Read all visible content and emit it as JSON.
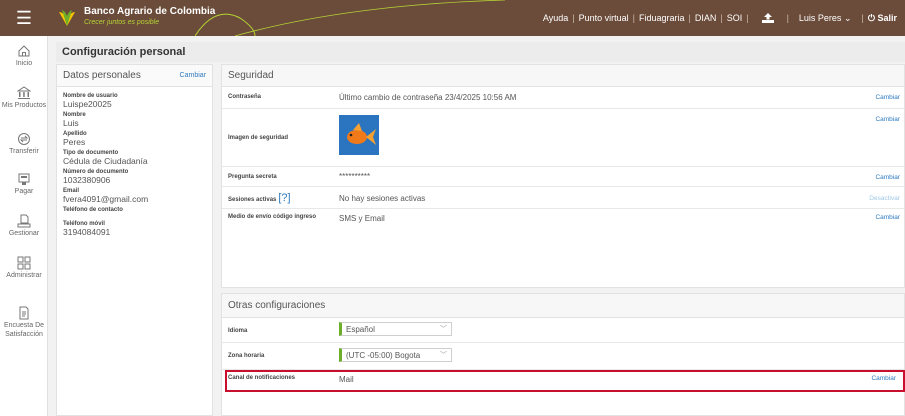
{
  "header": {
    "menu_icon": "hamburger-icon",
    "brand_name": "Banco Agrario de Colombia",
    "brand_slogan": "Crecer juntos es posible",
    "nav": [
      "Ayuda",
      "Punto virtual",
      "Fiduagraria",
      "DIAN",
      "SOI"
    ],
    "user_name": "Luis Peres",
    "logout_label": "Salir"
  },
  "sidebar": {
    "items": [
      {
        "label": "Inicio",
        "icon": "home-icon"
      },
      {
        "label": "Mis Productos",
        "icon": "bank-icon"
      },
      {
        "label": "Transferir",
        "icon": "transfer-icon"
      },
      {
        "label": "Pagar",
        "icon": "pay-icon"
      },
      {
        "label": "Gestionar",
        "icon": "manage-icon"
      },
      {
        "label": "Administrar",
        "icon": "grid-icon"
      },
      {
        "label": "Encuesta De Satisfacción",
        "icon": "survey-icon"
      }
    ]
  },
  "page": {
    "title": "Configuración personal"
  },
  "personal": {
    "title": "Datos personales",
    "action": "Cambiar",
    "fields": [
      {
        "label": "Nombre de usuario",
        "value": "Luispe20025"
      },
      {
        "label": "Nombre",
        "value": "Luis"
      },
      {
        "label": "Apellido",
        "value": "Peres"
      },
      {
        "label": "Tipo de documento",
        "value": "Cédula de Ciudadanía"
      },
      {
        "label": "Número de documento",
        "value": "1032380906"
      },
      {
        "label": "Email",
        "value": "fvera4091@gmail.com"
      },
      {
        "label": "Teléfono de contacto",
        "value": ""
      },
      {
        "label": "Teléfono móvil",
        "value": "3194084091"
      }
    ]
  },
  "security": {
    "title": "Seguridad",
    "password": {
      "label": "Contraseña",
      "value": "Último cambio de contraseña 23/4/2025 10:56 AM",
      "action": "Cambiar"
    },
    "image": {
      "label": "Imagen de seguridad",
      "action": "Cambiar"
    },
    "secret": {
      "label": "Pregunta secreta",
      "value": "**********",
      "action": "Cambiar"
    },
    "sessions": {
      "label": "Sesiones activas",
      "help": "[?]",
      "value": "No hay sesiones activas",
      "action": "Desactivar"
    },
    "code": {
      "label": "Medio de envío código ingreso",
      "value": "SMS y Email",
      "action": "Cambiar"
    }
  },
  "other": {
    "title": "Otras configuraciones",
    "language": {
      "label": "Idioma",
      "value": "Español"
    },
    "timezone": {
      "label": "Zona horaria",
      "value": "(UTC -05:00) Bogota"
    },
    "notifications": {
      "label": "Canal de notificaciones",
      "value": "Mail",
      "action": "Cambiar"
    }
  },
  "colors": {
    "header": "#6b4c3a",
    "accent": "#b5d334",
    "link": "#2e7bbf",
    "highlight": "#c8102e"
  }
}
